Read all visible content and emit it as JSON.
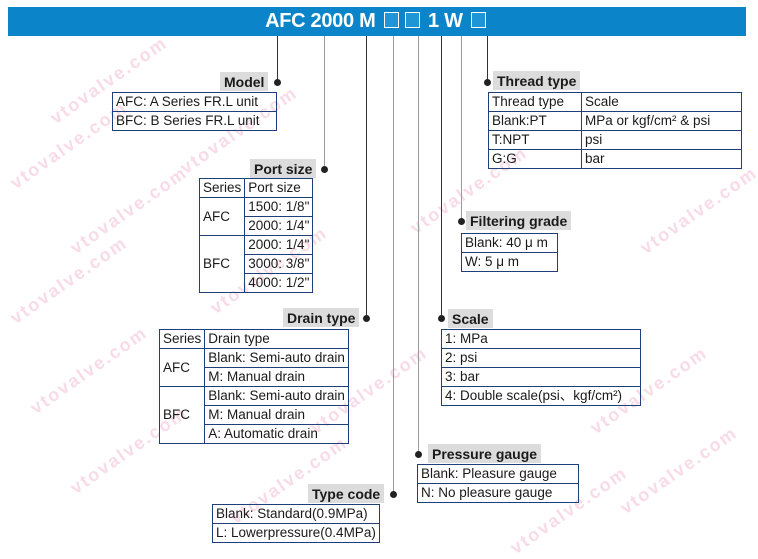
{
  "title": {
    "parts": [
      "AFC 2000 M",
      "1 W"
    ],
    "placeholder_boxes": 3
  },
  "watermark": "vtovalve.com",
  "model": {
    "label": "Model",
    "rows": [
      "AFC: A Series FR.L unit",
      "BFC: B Series FR.L unit"
    ]
  },
  "port_size": {
    "label": "Port size",
    "headers": [
      "Series",
      "Port size"
    ],
    "groups": [
      {
        "series": "AFC",
        "values": [
          "1500: 1/8\"",
          "2000: 1/4\""
        ]
      },
      {
        "series": "BFC",
        "values": [
          "2000: 1/4\"",
          "3000: 3/8\"",
          "4000: 1/2\""
        ]
      }
    ]
  },
  "drain_type": {
    "label": "Drain type",
    "headers": [
      "Series",
      "Drain type"
    ],
    "groups": [
      {
        "series": "AFC",
        "values": [
          "Blank: Semi-auto drain",
          "M: Manual drain"
        ]
      },
      {
        "series": "BFC",
        "values": [
          "Blank: Semi-auto drain",
          "M: Manual drain",
          "A: Automatic drain"
        ]
      }
    ]
  },
  "type_code": {
    "label": "Type code",
    "rows": [
      "Blank: Standard(0.9MPa)",
      "L: Lowerpressure(0.4MPa)"
    ]
  },
  "pressure_gauge": {
    "label": "Pressure gauge",
    "rows": [
      "Blank: Pleasure gauge",
      "N: No pleasure gauge"
    ]
  },
  "scale": {
    "label": "Scale",
    "rows": [
      "1: MPa",
      "2: psi",
      "3: bar",
      "4: Double scale(psi、kgf/cm²)"
    ]
  },
  "filtering_grade": {
    "label": "Filtering grade",
    "rows": [
      "Blank: 40 μ m",
      "W: 5 μ m"
    ]
  },
  "thread_type": {
    "label": "Thread type",
    "headers": [
      "Thread type",
      "Scale"
    ],
    "rows": [
      [
        "Blank:PT",
        "MPa or  kgf/cm² & psi"
      ],
      [
        "T:NPT",
        "psi"
      ],
      [
        "G:G",
        "bar"
      ]
    ]
  }
}
